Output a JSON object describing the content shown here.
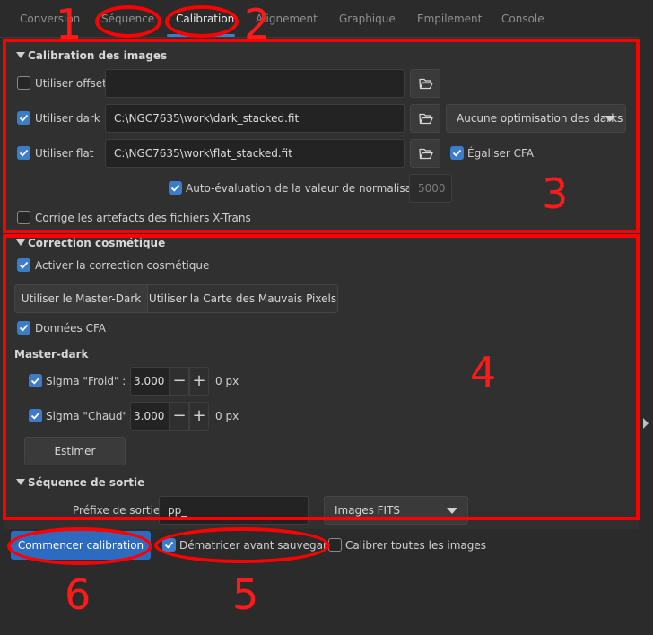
{
  "tabs": [
    {
      "label": "Conversion"
    },
    {
      "label": "Séquence"
    },
    {
      "label": "Calibration"
    },
    {
      "label": "Alignement"
    },
    {
      "label": "Graphique"
    },
    {
      "label": "Empilement"
    },
    {
      "label": "Console"
    }
  ],
  "calibration": {
    "title": "Calibration des images",
    "offset": {
      "label": "Utiliser offset",
      "checked": false,
      "path": ""
    },
    "dark": {
      "label": "Utiliser dark",
      "checked": true,
      "path": "C:\\NGC7635\\work\\dark_stacked.fit",
      "optimization": "Aucune optimisation des darks"
    },
    "flat": {
      "label": "Utiliser flat",
      "checked": true,
      "path": "C:\\NGC7635\\work\\flat_stacked.fit",
      "equalize_cfa_label": "Égaliser CFA",
      "equalize_cfa_checked": true
    },
    "auto_norm": {
      "label": "Auto-évaluation de la valeur de normalisation",
      "checked": true,
      "value": "5000"
    },
    "xtrans": {
      "label": "Corrige les artefacts des fichiers X-Trans",
      "checked": false
    }
  },
  "cosmetic": {
    "title": "Correction cosmétique",
    "activate": {
      "label": "Activer la correction cosmétique",
      "checked": true
    },
    "mode_master_dark": "Utiliser le Master-Dark",
    "mode_bad_pixels": "Utiliser la Carte des Mauvais Pixels",
    "cfa_data": {
      "label": "Données CFA",
      "checked": true
    },
    "master_dark_title": "Master-dark",
    "sigma_cold": {
      "label": "Sigma \"Froid\" :",
      "checked": true,
      "value": "3.000",
      "unit": "0 px"
    },
    "sigma_hot": {
      "label": "Sigma \"Chaud\" :",
      "checked": true,
      "value": "3.000",
      "unit": "0 px"
    },
    "estimate_label": "Estimer"
  },
  "output": {
    "title": "Séquence de sortie",
    "prefix_label": "Préfixe de sortie :",
    "prefix_value": "pp_",
    "format": "Images FITS"
  },
  "footer": {
    "start_label": "Commencer calibration",
    "debayer": {
      "label": "Dématricer avant sauvegarde",
      "checked": true
    },
    "calibrate_all": {
      "label": "Calibrer toutes les images",
      "checked": false
    }
  },
  "annotations": {
    "markers": [
      "1",
      "2",
      "3",
      "4",
      "5",
      "6"
    ],
    "color": "#ff0000"
  },
  "colors": {
    "accent": "#3d7cc9",
    "primary_button": "#2c6bc0",
    "background": "#2b2b2b"
  }
}
